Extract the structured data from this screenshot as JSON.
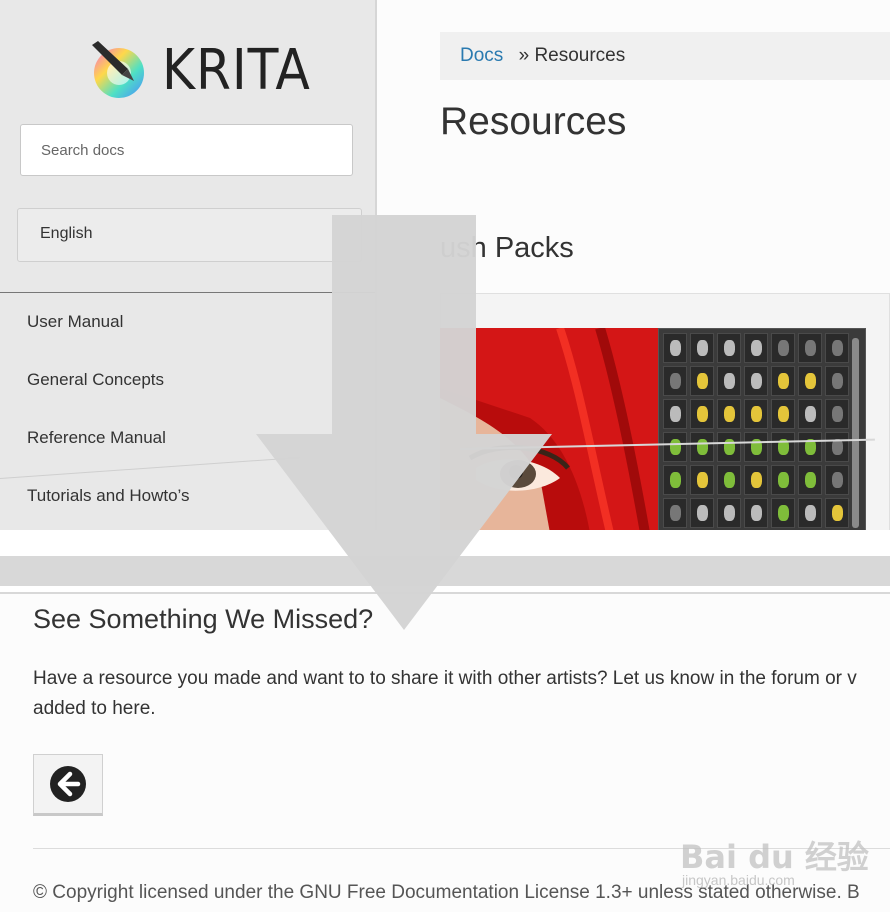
{
  "sidebar": {
    "logo_text": "KRITA",
    "search": {
      "placeholder": "Search docs"
    },
    "language": "English",
    "nav": [
      {
        "label": "User Manual"
      },
      {
        "label": "General Concepts"
      },
      {
        "label": "Reference Manual"
      },
      {
        "label": "Tutorials and Howto’s"
      }
    ]
  },
  "breadcrumb": {
    "root": "Docs",
    "separator": "»",
    "current": "Resources"
  },
  "main": {
    "title": "Resources",
    "section_title": "ush Packs"
  },
  "bottom": {
    "title": "See Something We Missed?",
    "text": "Have a resource you made and want to to share it with other artists? Let us know in the forum or v added to here.",
    "back_icon": "arrow-left-icon",
    "footer": "© Copyright licensed under the GNU Free Documentation License 1.3+ unless stated otherwise. B"
  },
  "watermark": {
    "logo": "Bai du 经验",
    "url": "jingyan.baidu.com"
  },
  "colors": {
    "link": "#2a7ab0",
    "sidebar_bg": "#e8e8e8",
    "overlay_arrow": "#d4d4d4"
  }
}
